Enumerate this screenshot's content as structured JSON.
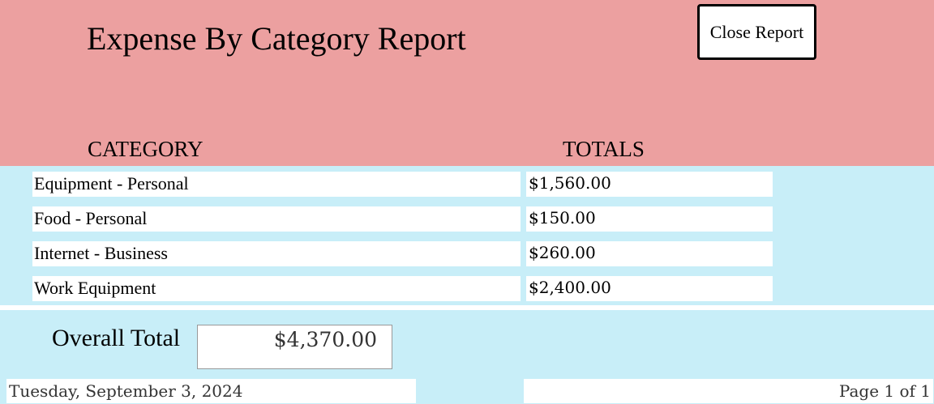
{
  "report": {
    "title": "Expense By Category Report",
    "close_label": "Close Report",
    "columns": {
      "category": "CATEGORY",
      "totals": "TOTALS"
    },
    "rows": [
      {
        "category": "Equipment - Personal",
        "total": "$1,560.00"
      },
      {
        "category": "Food - Personal",
        "total": "$150.00"
      },
      {
        "category": "Internet - Business",
        "total": "$260.00"
      },
      {
        "category": "Work Equipment",
        "total": "$2,400.00"
      }
    ],
    "overall_label": "Overall Total",
    "overall_total": "$4,370.00",
    "date": "Tuesday, September 3, 2024",
    "page": "Page 1 of 1"
  },
  "colors": {
    "header_bg": "#eca0a0",
    "detail_bg": "#c8eef8"
  }
}
